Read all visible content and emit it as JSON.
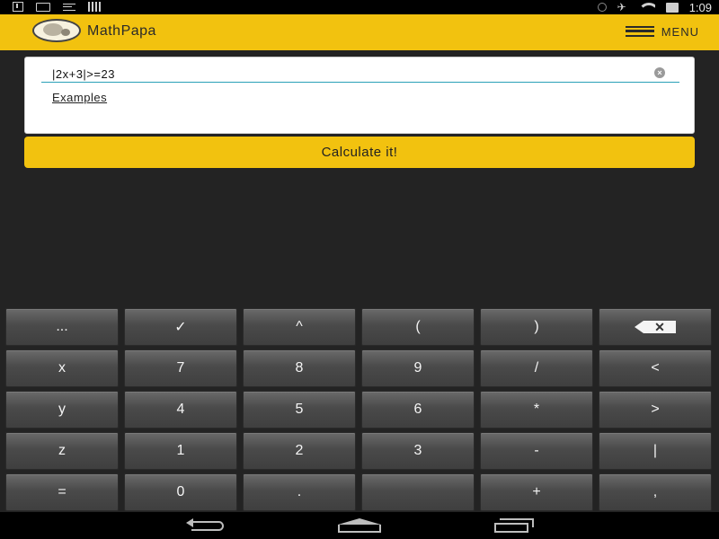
{
  "status_bar": {
    "time": "1:09"
  },
  "app_bar": {
    "title": "MathPapa",
    "menu_label": "MENU"
  },
  "input": {
    "value": "|2x+3|>=23",
    "clear_icon": "close-circle-icon",
    "examples_label": "Examples"
  },
  "calculate_label": "Calculate it!",
  "keypad": {
    "keys": [
      "...",
      "✓",
      "^",
      "(",
      ")",
      "",
      "x",
      "7",
      "8",
      "9",
      "/",
      "<",
      "y",
      "4",
      "5",
      "6",
      "*",
      ">",
      "z",
      "1",
      "2",
      "3",
      "-",
      "|",
      "=",
      "0",
      ".",
      "",
      "+",
      ","
    ],
    "backspace_icon": "backspace-icon"
  },
  "navigation": {
    "icons": [
      "back-icon",
      "home-icon",
      "recent-apps-icon"
    ]
  },
  "colors": {
    "accent": "#f2c20f",
    "background": "#232323",
    "input_underline": "#2aa0b8"
  }
}
